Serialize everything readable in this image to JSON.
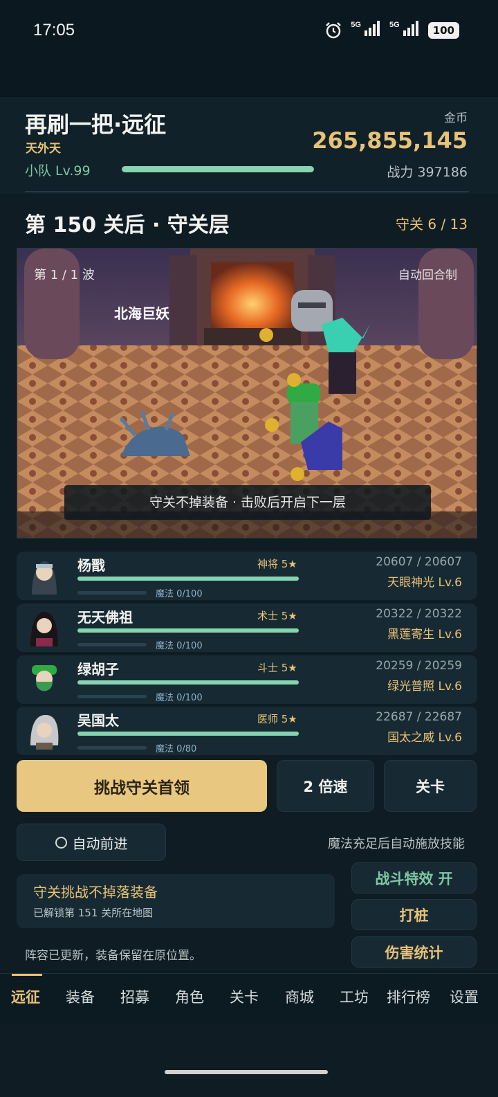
{
  "status": {
    "time": "17:05",
    "net1": "5G",
    "net2": "5G",
    "battery": "100"
  },
  "header": {
    "title": "再刷一把·远征",
    "realm": "天外天",
    "team_level": "小队 Lv.99",
    "team_progress": 1.0,
    "gold_label": "金币",
    "gold_value": "265,855,145",
    "power": "战力 397186"
  },
  "stage": {
    "title": "第 150 关后 · 守关层",
    "guard": "守关 6 / 13"
  },
  "battle": {
    "wave": "第 1 / 1 波",
    "mode": "自动回合制",
    "boss": "北海巨妖",
    "banner": "守关不掉装备 · 击败后开启下一层"
  },
  "heroes": [
    {
      "name": "杨戬",
      "class": "神将 5★",
      "hp": "20607 / 20607",
      "skill": "天眼神光 Lv.6",
      "mp": "魔法 0/100",
      "hp_fraction": 1.0,
      "mp_fraction": 0
    },
    {
      "name": "无天佛祖",
      "class": "术士 5★",
      "hp": "20322 / 20322",
      "skill": "黑莲寄生 Lv.6",
      "mp": "魔法 0/100",
      "hp_fraction": 1.0,
      "mp_fraction": 0
    },
    {
      "name": "绿胡子",
      "class": "斗士 5★",
      "hp": "20259 / 20259",
      "skill": "绿光普照 Lv.6",
      "mp": "魔法 0/100",
      "hp_fraction": 1.0,
      "mp_fraction": 0
    },
    {
      "name": "吴国太",
      "class": "医师 5★",
      "hp": "22687 / 22687",
      "skill": "国太之威 Lv.6",
      "mp": "魔法 0/80",
      "hp_fraction": 1.0,
      "mp_fraction": 0
    }
  ],
  "actions": {
    "challenge": "挑战守关首领",
    "speed": "2 倍速",
    "stage": "关卡",
    "auto_advance": "自动前进",
    "auto_skill_note": "魔法充足后自动施放技能",
    "effects": "战斗特效 开",
    "dummy": "打桩",
    "damage_stats": "伤害统计"
  },
  "notice": {
    "title": "守关挑战不掉落装备",
    "sub": "已解锁第 151 关所在地图"
  },
  "lineup_note": "阵容已更新，装备保留在原位置。",
  "tabs": [
    "远征",
    "装备",
    "招募",
    "角色",
    "关卡",
    "商城",
    "工坊",
    "排行榜",
    "设置"
  ],
  "colors": {
    "gold": "#e8c277",
    "accent_green": "#86d4b0",
    "bg": "#0f1c24",
    "card": "#172a33",
    "primary_button": "#e8c880"
  }
}
